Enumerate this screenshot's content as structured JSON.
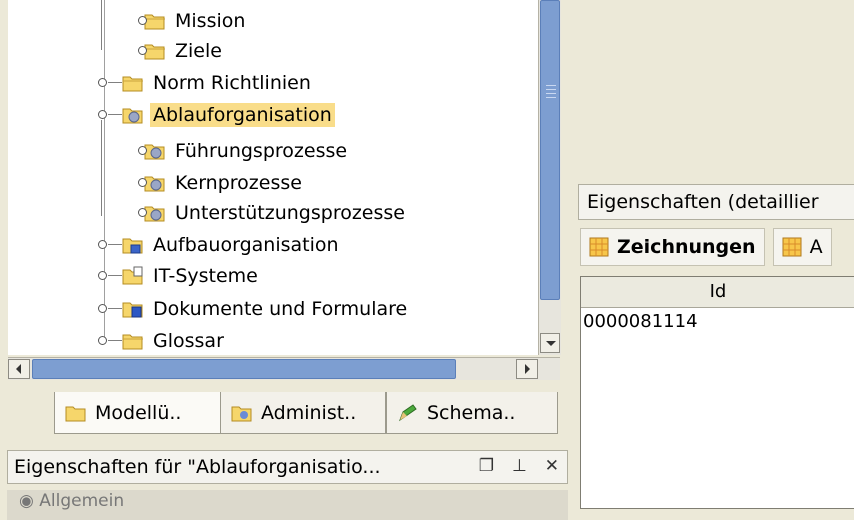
{
  "tree": {
    "nodes": [
      {
        "label": "Mission",
        "icon": "folder-icon"
      },
      {
        "label": "Ziele",
        "icon": "folder-icon"
      },
      {
        "label": "Norm Richtlinien",
        "icon": "folder-icon"
      },
      {
        "label": "Ablauforganisation",
        "icon": "process-folder-icon",
        "selected": true
      },
      {
        "label": "Führungsprozesse",
        "icon": "process-folder-icon"
      },
      {
        "label": "Kernprozesse",
        "icon": "process-folder-icon"
      },
      {
        "label": "Unterstützungsprozesse",
        "icon": "process-folder-icon"
      },
      {
        "label": "Aufbauorganisation",
        "icon": "org-folder-icon"
      },
      {
        "label": "IT-Systeme",
        "icon": "it-folder-icon"
      },
      {
        "label": "Dokumente und Formulare",
        "icon": "doc-folder-icon"
      },
      {
        "label": "Glossar",
        "icon": "folder-icon"
      }
    ]
  },
  "tabs": [
    {
      "label": "Modellü..",
      "icon": "folder-icon"
    },
    {
      "label": "Administ..",
      "icon": "admin-folder-icon"
    },
    {
      "label": "Schema..",
      "icon": "pencil-icon"
    }
  ],
  "properties_left": {
    "title": "Eigenschaften für \"Ablauforganisatio...",
    "section": "Allgemein"
  },
  "properties_right": {
    "title": "Eigenschaften (detaillier"
  },
  "toolbar": {
    "drawings_label": "Zeichnungen",
    "second_label": "A"
  },
  "grid": {
    "column": "Id",
    "rows": [
      "0000081114"
    ]
  },
  "colors": {
    "selection": "#f9dd8a",
    "scroll_thumb": "#7d9ed1",
    "background": "#ece9d8"
  }
}
